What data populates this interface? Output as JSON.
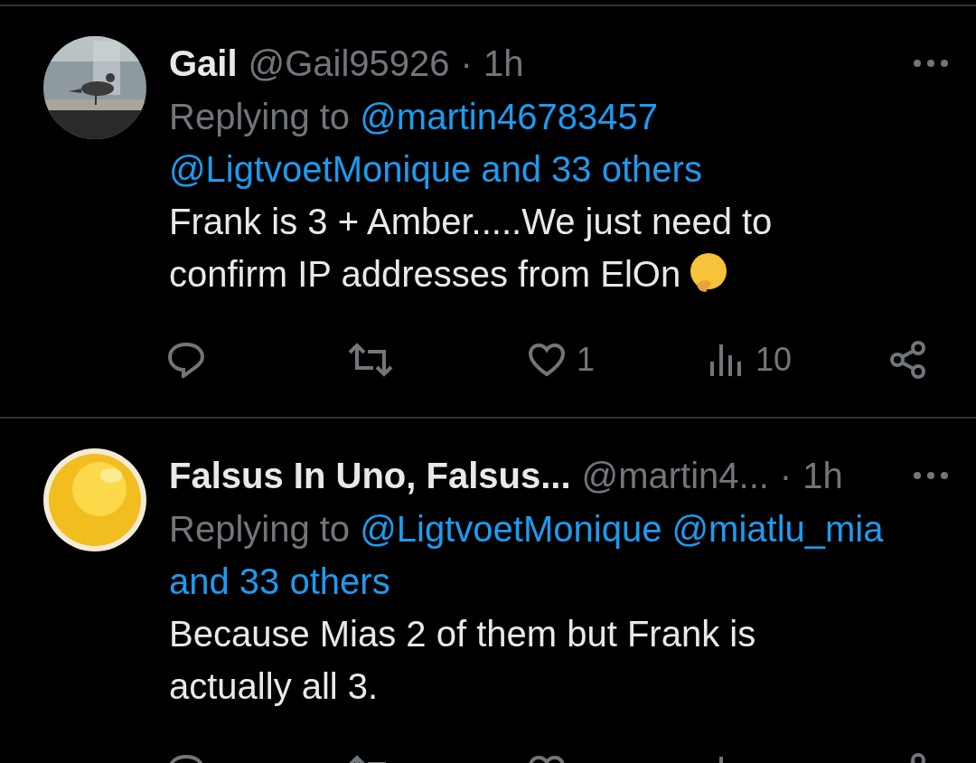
{
  "tweets": [
    {
      "avatar": {
        "kind": "picture"
      },
      "name": "Gail",
      "handle": "@Gail95926",
      "separator": "·",
      "time": "1h",
      "reply_prefix": "Replying to",
      "reply_to": [
        "@martin46783457",
        "@LigtvoetMonique and 33 others"
      ],
      "text": "Frank is 3 + Amber.....We just need to confirm IP addresses from ElOn",
      "emoji_after": true,
      "actions": [
        {
          "kind": "reply"
        },
        {
          "kind": "repost"
        },
        {
          "kind": "like",
          "count": "1"
        },
        {
          "kind": "views",
          "count": "10"
        },
        {
          "kind": "share"
        }
      ]
    },
    {
      "avatar": {
        "kind": "emoji"
      },
      "name": "Falsus In Uno, Falsus...",
      "handle": "@martin4...",
      "separator": "·",
      "time": "1h",
      "reply_prefix": "Replying to",
      "reply_to": [
        "@LigtvoetMonique",
        "@miatlu_mia",
        "and 33 others"
      ],
      "text": "Because Mias 2 of them but Frank is actually all 3.",
      "actions": [
        {
          "kind": "reply"
        },
        {
          "kind": "repost"
        },
        {
          "kind": "like"
        },
        {
          "kind": "views"
        },
        {
          "kind": "share"
        }
      ]
    }
  ]
}
